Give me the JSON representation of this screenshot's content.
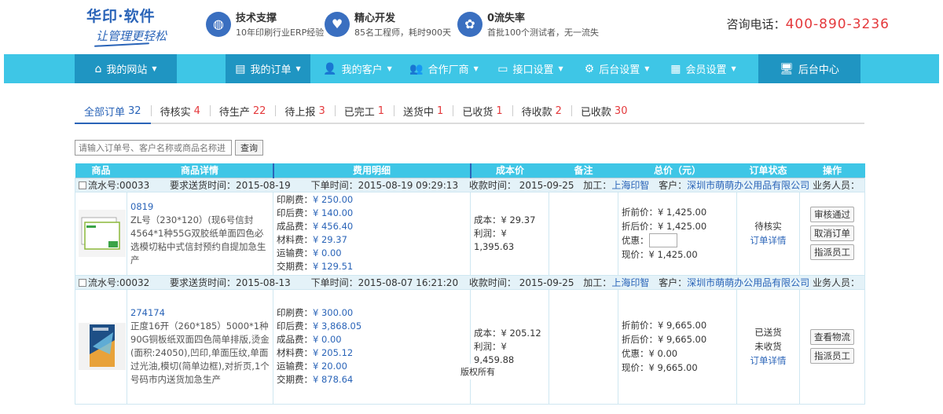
{
  "header": {
    "logo_line1": "华印·软件",
    "logo_line2": "让管理更轻松",
    "features": [
      {
        "icon": "basketball-icon",
        "title": "技术支撑",
        "desc": "10年印刷行业ERP经验"
      },
      {
        "icon": "heart-icon",
        "title": "精心开发",
        "desc": "85名工程师，耗时900天"
      },
      {
        "icon": "people-icon",
        "title": "0流失率",
        "desc": "首批100个测试者，无一流失"
      }
    ],
    "hotline_label": "咨询电话：",
    "hotline_number": "400-890-3236"
  },
  "nav": {
    "items": [
      {
        "label": "我的网站",
        "icon": "home-icon",
        "caret": "▼"
      },
      {
        "label": "我的订单",
        "icon": "document-icon",
        "caret": "▼"
      },
      {
        "label": "我的客户",
        "icon": "user-icon",
        "caret": "▼"
      },
      {
        "label": "合作厂商",
        "icon": "group-icon",
        "caret": "▼"
      },
      {
        "label": "接口设置",
        "icon": "monitor-icon",
        "caret": "▼"
      },
      {
        "label": "后台设置",
        "icon": "gear-icon",
        "caret": "▼"
      },
      {
        "label": "会员设置",
        "icon": "card-icon",
        "caret": "▼"
      },
      {
        "label": "后台中心",
        "icon": "screen-icon",
        "caret": ""
      }
    ]
  },
  "tabs": [
    {
      "label": "全部订单",
      "count": "32"
    },
    {
      "label": "待核实",
      "count": "4"
    },
    {
      "label": "待生产",
      "count": "22"
    },
    {
      "label": "待上报",
      "count": "3"
    },
    {
      "label": "已完工",
      "count": "1"
    },
    {
      "label": "送货中",
      "count": "1"
    },
    {
      "label": "已收货",
      "count": "1"
    },
    {
      "label": "待收款",
      "count": "2"
    },
    {
      "label": "已收款",
      "count": "30"
    }
  ],
  "search": {
    "placeholder": "请输入订单号、客户名称或商品名称进",
    "button": "查询"
  },
  "table": {
    "headers": [
      "商品",
      "商品详情",
      "费用明细",
      "成本价",
      "备注",
      "总价（元）",
      "订单状态",
      "操作"
    ],
    "orders": [
      {
        "serial": "流水号:00033",
        "delivery": "要求送货时间：2015-08-19",
        "order_time": "下单时间：2015-08-19 09:29:13",
        "receive_time": "收款时间： 2015-09-25",
        "process_label": "加工：",
        "process": "上海印智",
        "customer_label": "客户：",
        "customer": "深圳市萌萌办公用品有限公司",
        "staff": "业务人员：",
        "code": "0819",
        "desc": "ZL号（230*120）(现6号信封4564*1种55G双胶纸单面四色必选模切粘中式信封预约自提加急生产",
        "fees": [
          {
            "label": "印刷费：",
            "value": "¥ 250.00"
          },
          {
            "label": "印后费：",
            "value": "¥ 140.00"
          },
          {
            "label": "成品费：",
            "value": "¥ 456.40"
          },
          {
            "label": "材料费：",
            "value": "¥ 29.37"
          },
          {
            "label": "运输费：",
            "value": "¥ 0.00"
          },
          {
            "label": "交期费：",
            "value": "¥ 129.51"
          }
        ],
        "cost": "成本：¥ 29.37",
        "profit": "利润：¥ 1,395.63",
        "totals": {
          "before": "折前价：¥ 1,425.00",
          "after": "折后价：¥ 1,425.00",
          "discount": "优惠：",
          "now": "现价：¥ 1,425.00"
        },
        "status": [
          "待核实"
        ],
        "detail_link": "订单详情",
        "buttons": [
          "审核通过",
          "取消订单",
          "指派员工"
        ]
      },
      {
        "serial": "流水号:00032",
        "delivery": "要求送货时间：2015-08-13",
        "order_time": "下单时间：2015-08-07 16:21:20",
        "receive_time": "收款时间： 2015-09-25",
        "process_label": "加工：",
        "process": "上海印智",
        "customer_label": "客户：",
        "customer": "深圳市萌萌办公用品有限公司",
        "staff": "业务人员：",
        "code": "274174",
        "desc": "正度16开（260*185）5000*1种90G铜板纸双面四色简单排版,烫金(面积:24050),凹印,单面压纹,单面过光油,模切(简单边框),对折页,1个号码市内送货加急生产",
        "fees": [
          {
            "label": "印刷费：",
            "value": "¥ 300.00"
          },
          {
            "label": "印后费：",
            "value": "¥ 3,868.05"
          },
          {
            "label": "成品费：",
            "value": "¥ 0.00"
          },
          {
            "label": "材料费：",
            "value": "¥ 205.12"
          },
          {
            "label": "运输费：",
            "value": "¥ 20.00"
          },
          {
            "label": "交期费：",
            "value": "¥ 878.64"
          }
        ],
        "cost": "成本：¥ 205.12",
        "profit": "利润：¥ 9,459.88",
        "totals": {
          "before": "折前价：¥ 9,665.00",
          "after": "折后价：¥ 9,665.00",
          "discount": "优惠：¥ 0.00",
          "now": "现价：¥ 9,665.00"
        },
        "status": [
          "已送货",
          "未收货"
        ],
        "detail_link": "订单详情",
        "buttons": [
          "查看物流",
          "指派员工"
        ]
      }
    ]
  },
  "footer": {
    "copyright": "版权所有"
  }
}
